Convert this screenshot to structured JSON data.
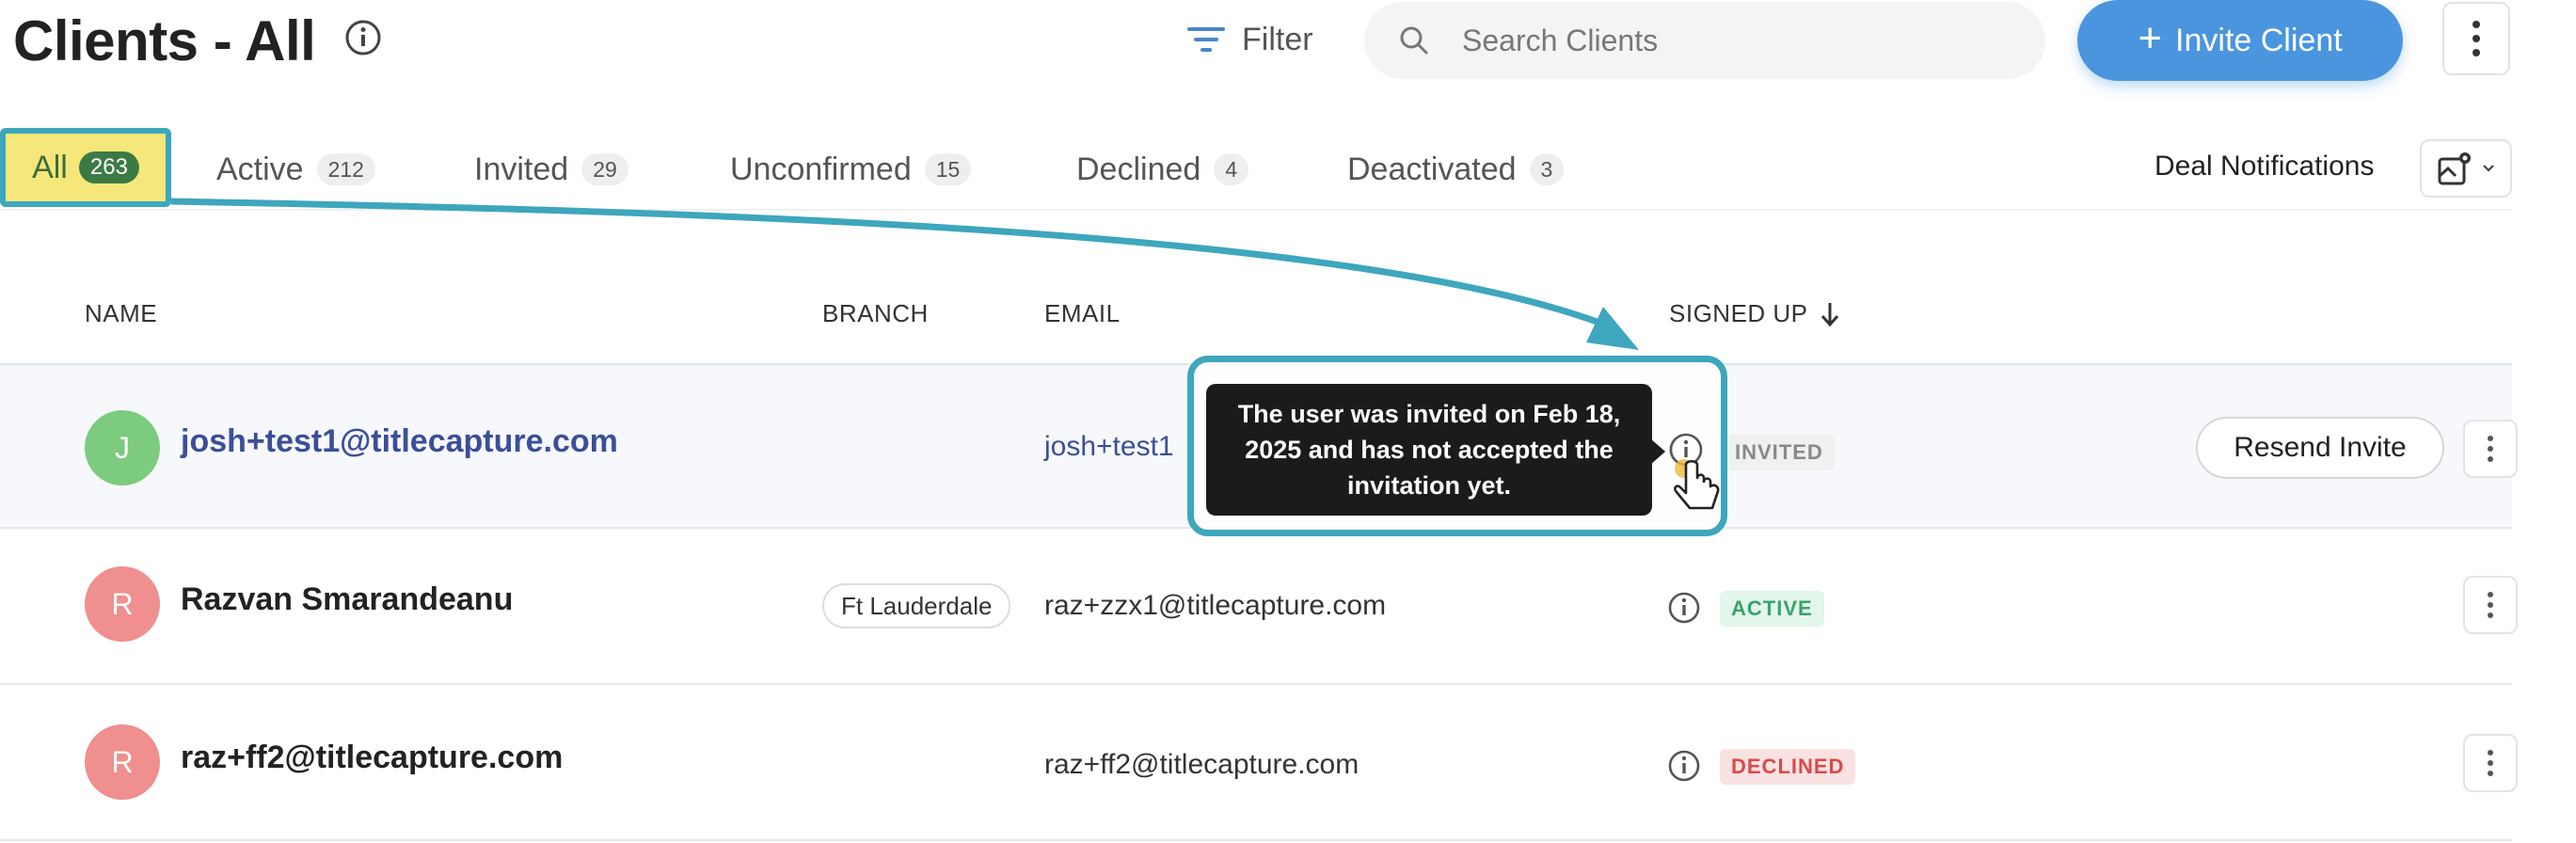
{
  "header": {
    "title": "Clients - All",
    "filter_label": "Filter",
    "search_placeholder": "Search Clients",
    "invite_label": "Invite Client"
  },
  "tabs": [
    {
      "label": "All",
      "count": "263",
      "selected": true
    },
    {
      "label": "Active",
      "count": "212"
    },
    {
      "label": "Invited",
      "count": "29"
    },
    {
      "label": "Unconfirmed",
      "count": "15"
    },
    {
      "label": "Declined",
      "count": "4"
    },
    {
      "label": "Deactivated",
      "count": "3"
    }
  ],
  "deal_notifications_label": "Deal Notifications",
  "table": {
    "columns": [
      "NAME",
      "BRANCH",
      "EMAIL",
      "SIGNED UP"
    ],
    "rows": [
      {
        "initial": "J",
        "avatar_color": "#7ccb7e",
        "name": "josh+test1@titlecapture.com",
        "branch": "",
        "email": "josh+test1@titlecapture.com",
        "email_visible": "josh+test1",
        "status": "INVITED",
        "action": "Resend Invite"
      },
      {
        "initial": "R",
        "avatar_color": "#ef8f8f",
        "name": "Razvan Smarandeanu",
        "branch": "Ft Lauderdale",
        "email": "raz+zzx1@titlecapture.com",
        "status": "ACTIVE"
      },
      {
        "initial": "R",
        "avatar_color": "#ef8f8f",
        "name": "raz+ff2@titlecapture.com",
        "branch": "",
        "email": "raz+ff2@titlecapture.com",
        "status": "DECLINED"
      }
    ]
  },
  "tooltip": {
    "text": "The user was invited on Feb 18, 2025 and has not accepted the invitation yet."
  },
  "colors": {
    "accent": "#4a95de",
    "highlight": "#3ea6bd",
    "tab_highlight": "#f6e77a"
  }
}
